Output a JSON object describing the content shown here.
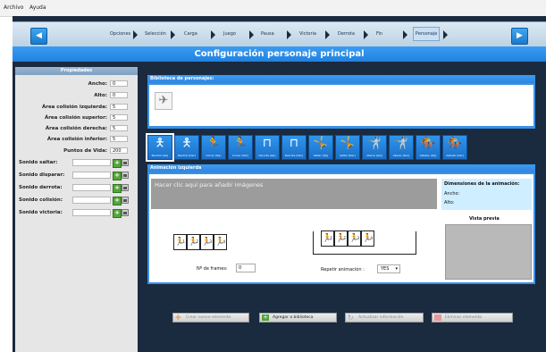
{
  "menu": {
    "archivo": "Archivo",
    "ayuda": "Ayuda"
  },
  "nav": {
    "back_icon": "left-arrow-icon",
    "forward_icon": "right-arrow-icon",
    "steps": [
      {
        "label": "Opciones"
      },
      {
        "label": "Selección"
      },
      {
        "label": "Carga"
      },
      {
        "label": "Juego"
      },
      {
        "label": "Pausa"
      },
      {
        "label": "Victoria"
      },
      {
        "label": "Derrota"
      },
      {
        "label": "Fin"
      },
      {
        "label": "Personaje"
      }
    ],
    "active": "Personaje"
  },
  "title": "Configuración personaje principal",
  "properties": {
    "header": "Propiedades",
    "fields": [
      {
        "label": "Ancho:",
        "value": "0"
      },
      {
        "label": "Alto:",
        "value": "0"
      },
      {
        "label": "Área colisión izquierda:",
        "value": "5"
      },
      {
        "label": "Área colisión superior:",
        "value": "5"
      },
      {
        "label": "Área colisión derecha:",
        "value": "5"
      },
      {
        "label": "Área colisión inferior:",
        "value": "5"
      },
      {
        "label": "Puntos de Vida:",
        "value": "200"
      }
    ],
    "sounds": [
      {
        "label": "Sonido saltar:"
      },
      {
        "label": "Sonido disparar:"
      },
      {
        "label": "Sonido derrota:"
      },
      {
        "label": "Sonido colisión:"
      },
      {
        "label": "Sonido victoria:"
      }
    ]
  },
  "library": {
    "header": "Biblioteca de personajes:"
  },
  "characters": [
    {
      "caption": "Neutral (Izq)"
    },
    {
      "caption": "Neutral (Der)"
    },
    {
      "caption": "Correr (Izq)"
    },
    {
      "caption": "Correr (Der)"
    },
    {
      "caption": "Derrota (Izq)"
    },
    {
      "caption": "Derrota (Der)"
    },
    {
      "caption": "Saltar (Izq)"
    },
    {
      "caption": "Saltar (Der)"
    },
    {
      "caption": "Atacar (Izq)"
    },
    {
      "caption": "Atacar (Der)"
    },
    {
      "caption": "Caballo (Izq)"
    },
    {
      "caption": "Caballo (Der)"
    }
  ],
  "animation": {
    "header": "Animación izquierda",
    "drop_text": "Hacer clic aquí para añadir imágenes",
    "dims_title": "Dimensiones de la animación:",
    "width_label": "Ancho:",
    "height_label": "Alto:",
    "preview_label": "Vista previa",
    "frames_label": "Nº de frames:",
    "frames_value": "0",
    "repeat_label": "Repetir animación :",
    "repeat_value": "YES",
    "frame_numbers": [
      "1",
      "2",
      "3",
      "4"
    ]
  },
  "buttons": {
    "create": "Crear nuevo elemento",
    "add": "Agregar a biblioteca",
    "update": "Actualizar información",
    "delete": "Eliminar elemento"
  }
}
